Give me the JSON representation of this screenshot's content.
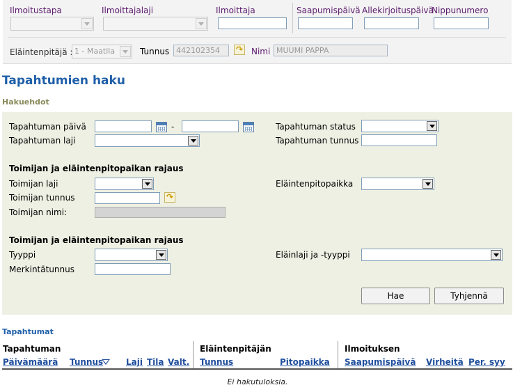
{
  "header": {
    "fields": {
      "ilmoitustapa": "Ilmoitustapa",
      "ilmoittajalaji": "Ilmoittajalaji",
      "ilmoittaja": "Ilmoittaja",
      "saapumispaiva": "Saapumispäivä",
      "allekirjoituspaiva": "Allekirjoituspäivä",
      "nippunumero": "Nippunumero"
    },
    "elaintenpitaja_label": "Eläintenpitäjä :",
    "elaintenpitaja_value": "1 - Maatila",
    "tunnus_label": "Tunnus",
    "tunnus_value": "442102354",
    "nimi_label": "Nimi",
    "nimi_value": "MUUMI PAPPA"
  },
  "page_title": "Tapahtumien haku",
  "section_title": "Hakuehdot",
  "search": {
    "tapahtuman_paiva": "Tapahtuman päivä",
    "date_separator": "-",
    "tapahtuman_status": "Tapahtuman status",
    "tapahtuman_laji": "Tapahtuman laji",
    "tapahtuman_tunnus": "Tapahtuman tunnus",
    "group1_title": "Toimijan ja eläintenpitopaikan rajaus",
    "toimijan_laji": "Toimijan laji",
    "elaintenpitopaikka": "Eläintenpitopaikka",
    "toimijan_tunnus": "Toimijan tunnus",
    "toimijan_nimi": "Toimijan nimi:",
    "group2_title": "Toimijan ja eläintenpitopaikan rajaus",
    "tyyppi": "Tyyppi",
    "elainlaji_tyyppi": "Eläinlaji ja -tyyppi",
    "merkintatunnus": "Merkintätunnus",
    "hae_button": "Hae",
    "tyhjenna_button": "Tyhjennä"
  },
  "results": {
    "title": "Tapahtumat",
    "group_headers": [
      "Tapahtuman",
      "Eläintenpitäjän",
      "Ilmoituksen"
    ],
    "columns": [
      "Päivämäärä",
      "Tunnus",
      "Laji",
      "Tila",
      "Valt.",
      "Tunnus",
      "Pitopaikka",
      "Saapumispäivä",
      "Virheitä",
      "Per. syy"
    ],
    "empty_message": "Ei hakutuloksia."
  },
  "colors": {
    "header_bg": "#f3f3f3",
    "form_bg": "#eef0e3",
    "title_blue": "#1f5fa8",
    "section_olive": "#8a8a5c"
  }
}
